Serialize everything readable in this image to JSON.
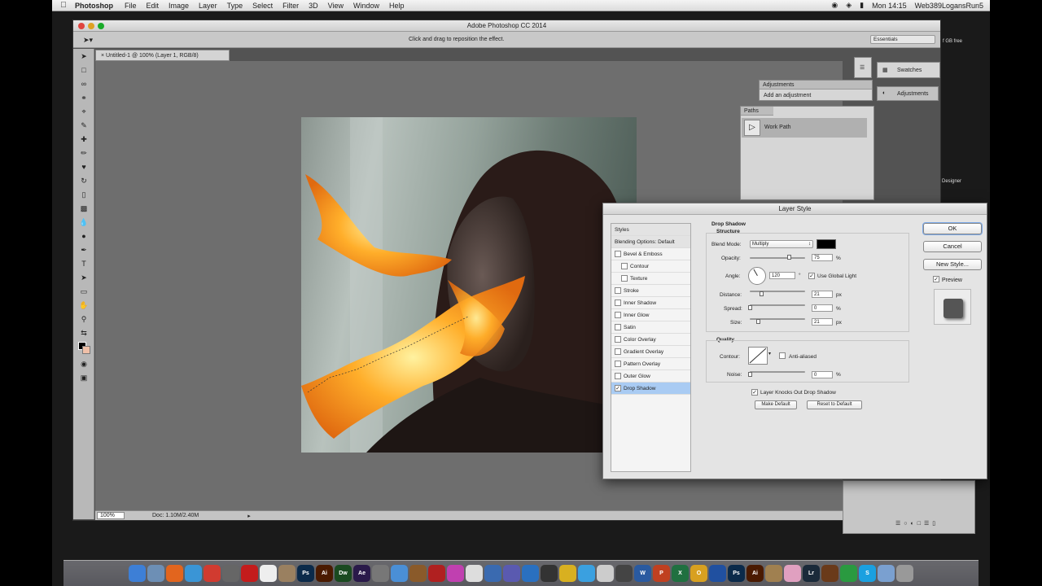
{
  "menubar": {
    "app": "Photoshop",
    "items": [
      "File",
      "Edit",
      "Image",
      "Layer",
      "Type",
      "Select",
      "Filter",
      "3D",
      "View",
      "Window",
      "Help"
    ],
    "clock": "Mon 14:15",
    "user": "Web389LogansRun5"
  },
  "window": {
    "title": "Adobe Photoshop CC 2014",
    "hint": "Click and drag to reposition the effect.",
    "workspace": "Essentials",
    "doc_tab": "Untitled-1 @ 100% (Layer 1, RGB/8)",
    "zoom": "100%",
    "doc_info": "Doc: 1.10M/2.40M"
  },
  "desktop": {
    "label_top": "f GB free",
    "label_mid": "Designer"
  },
  "panels": {
    "swatches": "Swatches",
    "adjustments_tab": "Adjustments",
    "adjustments_hint": "Add an adjustment",
    "paths_tab": "Paths",
    "work_path": "Work Path",
    "side_adjustments": "Adjustments"
  },
  "dialog": {
    "title": "Layer Style",
    "styles_header": "Styles",
    "blending": "Blending Options: Default",
    "effects": [
      {
        "label": "Bevel & Emboss",
        "checked": false,
        "sub": false
      },
      {
        "label": "Contour",
        "checked": false,
        "sub": true
      },
      {
        "label": "Texture",
        "checked": false,
        "sub": true
      },
      {
        "label": "Stroke",
        "checked": false,
        "sub": false
      },
      {
        "label": "Inner Shadow",
        "checked": false,
        "sub": false
      },
      {
        "label": "Inner Glow",
        "checked": false,
        "sub": false
      },
      {
        "label": "Satin",
        "checked": false,
        "sub": false
      },
      {
        "label": "Color Overlay",
        "checked": false,
        "sub": false
      },
      {
        "label": "Gradient Overlay",
        "checked": false,
        "sub": false
      },
      {
        "label": "Pattern Overlay",
        "checked": false,
        "sub": false
      },
      {
        "label": "Outer Glow",
        "checked": false,
        "sub": false
      },
      {
        "label": "Drop Shadow",
        "checked": true,
        "sub": false
      }
    ],
    "section_title": "Drop Shadow",
    "structure": "Structure",
    "blend_mode_label": "Blend Mode:",
    "blend_mode": "Multiply",
    "shadow_color": "#000000",
    "opacity_label": "Opacity:",
    "opacity": "75",
    "angle_label": "Angle:",
    "angle": "120",
    "global_light": "Use Global Light",
    "distance_label": "Distance:",
    "distance": "21",
    "spread_label": "Spread:",
    "spread": "0",
    "size_label": "Size:",
    "size": "21",
    "quality": "Quality",
    "contour_label": "Contour:",
    "anti_aliased": "Anti-aliased",
    "noise_label": "Noise:",
    "noise": "0",
    "knockout": "Layer Knocks Out Drop Shadow",
    "make_default": "Make Default",
    "reset_default": "Reset to Default",
    "ok": "OK",
    "cancel": "Cancel",
    "new_style": "New Style...",
    "preview": "Preview",
    "unit_px": "px",
    "unit_pct": "%",
    "unit_deg": "°"
  },
  "dock": {
    "icons": [
      {
        "name": "finder",
        "label": "",
        "color": "#3d7fd6"
      },
      {
        "name": "preview",
        "label": "",
        "color": "#6d8fb5"
      },
      {
        "name": "firefox",
        "label": "",
        "color": "#e2651e"
      },
      {
        "name": "safari",
        "label": "",
        "color": "#3a95d6"
      },
      {
        "name": "chrome",
        "label": "",
        "color": "#d13b30"
      },
      {
        "name": "app-store",
        "label": "",
        "color": "#666"
      },
      {
        "name": "opera",
        "label": "",
        "color": "#c41c1c"
      },
      {
        "name": "calendar",
        "label": "",
        "color": "#eee"
      },
      {
        "name": "photos",
        "label": "",
        "color": "#9a8060"
      },
      {
        "name": "photoshop",
        "label": "Ps",
        "color": "#0b2a4a"
      },
      {
        "name": "illustrator",
        "label": "Ai",
        "color": "#4a1a00"
      },
      {
        "name": "dreamweaver",
        "label": "Dw",
        "color": "#1a4a20"
      },
      {
        "name": "after-effects",
        "label": "Ae",
        "color": "#2a1a4a"
      },
      {
        "name": "utility",
        "label": "",
        "color": "#777"
      },
      {
        "name": "mail",
        "label": "",
        "color": "#4a8fd6"
      },
      {
        "name": "guitar",
        "label": "",
        "color": "#8a5a2a"
      },
      {
        "name": "app-red",
        "label": "",
        "color": "#b02020"
      },
      {
        "name": "itunes",
        "label": "",
        "color": "#c040b0"
      },
      {
        "name": "textedit",
        "label": "",
        "color": "#ddd"
      },
      {
        "name": "network",
        "label": "",
        "color": "#3a6ab0"
      },
      {
        "name": "colorsync",
        "label": "",
        "color": "#5a5ab0"
      },
      {
        "name": "sketch",
        "label": "",
        "color": "#2a70c0"
      },
      {
        "name": "cursor",
        "label": "",
        "color": "#333"
      },
      {
        "name": "app-yellow",
        "label": "",
        "color": "#d8b020"
      },
      {
        "name": "twitter",
        "label": "",
        "color": "#3aa0e0"
      },
      {
        "name": "app-white",
        "label": "",
        "color": "#ccc"
      },
      {
        "name": "camera",
        "label": "",
        "color": "#444"
      },
      {
        "name": "word",
        "label": "W",
        "color": "#2a5aa0"
      },
      {
        "name": "powerpoint",
        "label": "P",
        "color": "#c04020"
      },
      {
        "name": "excel",
        "label": "X",
        "color": "#207040"
      },
      {
        "name": "outlook",
        "label": "O",
        "color": "#d8a020"
      },
      {
        "name": "app-blue",
        "label": "",
        "color": "#2050a0"
      },
      {
        "name": "photoshop-2",
        "label": "Ps",
        "color": "#0b2a4a"
      },
      {
        "name": "illustrator-2",
        "label": "Ai",
        "color": "#4a1a00"
      },
      {
        "name": "app-tan",
        "label": "",
        "color": "#a08050"
      },
      {
        "name": "app-pink",
        "label": "",
        "color": "#e0a0c0"
      },
      {
        "name": "lightroom",
        "label": "Lr",
        "color": "#1a2a3a"
      },
      {
        "name": "app-brown",
        "label": "",
        "color": "#6a3a1a"
      },
      {
        "name": "spotify",
        "label": "",
        "color": "#2a9a40"
      },
      {
        "name": "skype",
        "label": "S",
        "color": "#1aa0e0"
      },
      {
        "name": "folder",
        "label": "",
        "color": "#7aa0d0"
      },
      {
        "name": "trash",
        "label": "",
        "color": "#999"
      }
    ]
  }
}
